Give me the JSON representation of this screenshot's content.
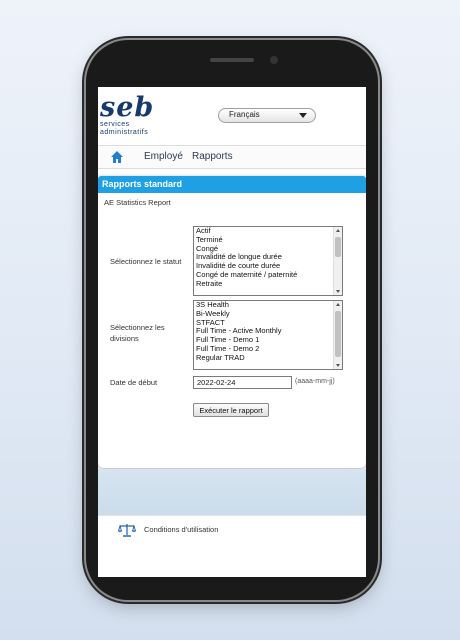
{
  "logo": {
    "main": "seb",
    "sub_line1": "services",
    "sub_line2": "administratifs"
  },
  "language": {
    "selected": "Français"
  },
  "nav": {
    "home_icon": "home-icon",
    "items": [
      "Employé",
      "Rapports"
    ]
  },
  "card": {
    "title": "Rapports standard",
    "report_name": "AE Statistics Report"
  },
  "status": {
    "label": "Sélectionnez le statut",
    "options": [
      "Actif",
      "Terminé",
      "Congé",
      "Invalidité de longue durée",
      "Invalidité de courte durée",
      "Congé de maternité / paternité",
      "Retraite"
    ]
  },
  "divisions": {
    "label_line1": "Sélectionnez les",
    "label_line2": "divisions",
    "options": [
      "3S Health",
      "Bi-Weekly",
      "STFACT",
      "Full Time - Active Monthly",
      "Full Time - Demo 1",
      "Full Time - Demo 2",
      "Regular TRAD"
    ]
  },
  "start_date": {
    "label": "Date de début",
    "value": "2022-02-24",
    "hint": "(aaaa-mm-jj)"
  },
  "run_button": {
    "label": "Exécuter le rapport"
  },
  "footer": {
    "terms_label": "Conditions d'utilisation",
    "icon": "scale-icon"
  },
  "colors": {
    "accent": "#1ea0e2",
    "brand": "#173a6e"
  }
}
